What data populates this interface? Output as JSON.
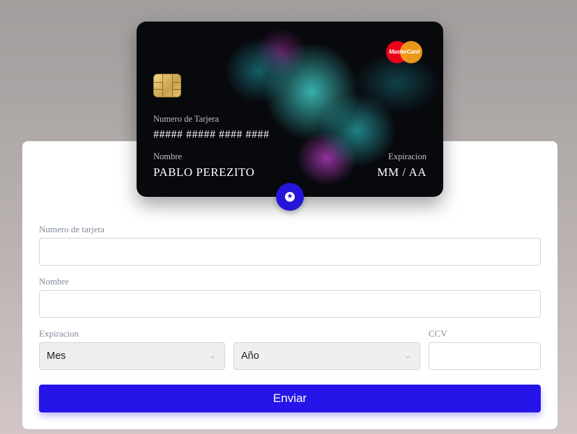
{
  "card": {
    "brand": "MasterCard",
    "number_label": "Numero de Tarjera",
    "number_value": "##### ##### #### ####",
    "name_label": "Nombre",
    "name_value": "PABLO PEREZITO",
    "expiry_label": "Expiracion",
    "expiry_value": "MM / AA"
  },
  "form": {
    "card_number_label": "Numero de tarjeta",
    "card_number_value": "",
    "name_label": "Nombre",
    "name_value": "",
    "expiry_label": "Expiracion",
    "month_selected": "Mes",
    "year_selected": "Año",
    "ccv_label": "CCV",
    "ccv_value": "",
    "submit_label": "Enviar"
  },
  "colors": {
    "accent": "#2515e8",
    "card_background": "#08090d"
  }
}
